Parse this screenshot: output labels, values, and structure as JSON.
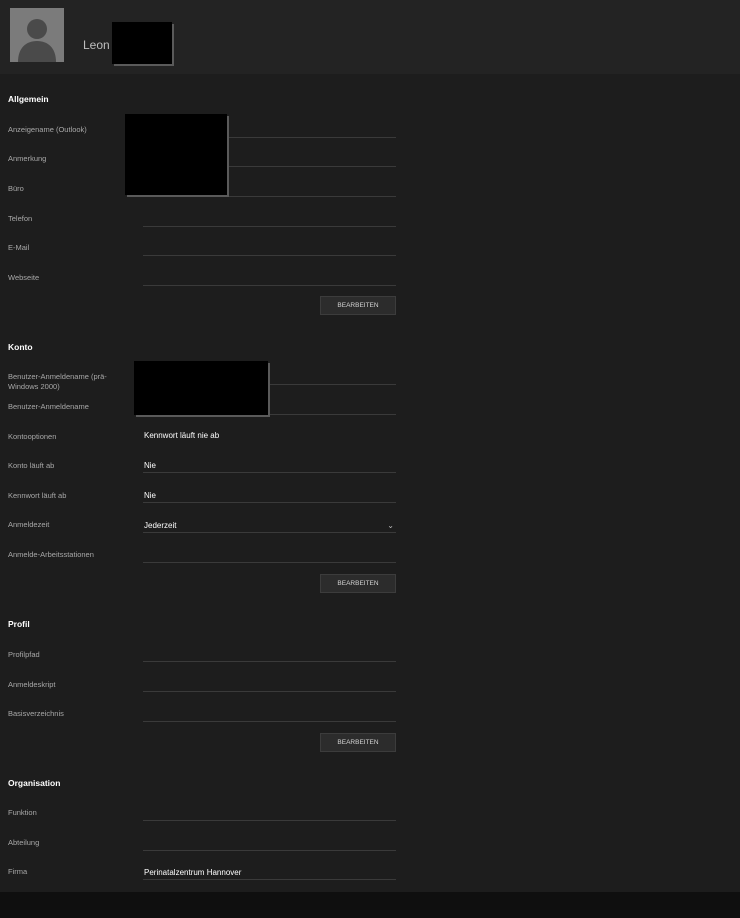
{
  "header": {
    "user_name": "Leon"
  },
  "sections": {
    "allgemein": {
      "title": "Allgemein",
      "fields": [
        {
          "label": "Anzeigename (Outlook)",
          "value": ""
        },
        {
          "label": "Anmerkung",
          "value": ""
        },
        {
          "label": "Büro",
          "value": ""
        },
        {
          "label": "Telefon",
          "value": ""
        },
        {
          "label": "E-Mail",
          "value": ""
        },
        {
          "label": "Webseite",
          "value": ""
        }
      ],
      "button": "BEARBEITEN"
    },
    "konto": {
      "title": "Konto",
      "fields": [
        {
          "label": "Benutzer-Anmeldename (prä-Windows 2000)",
          "value": ""
        },
        {
          "label": "Benutzer-Anmeldename",
          "value": ""
        },
        {
          "label": "Kontooptionen",
          "value": "Kennwort läuft nie ab"
        },
        {
          "label": "Konto läuft ab",
          "value": "Nie"
        },
        {
          "label": "Kennwort läuft ab",
          "value": "Nie"
        },
        {
          "label": "Anmeldezeit",
          "value": "Jederzeit"
        },
        {
          "label": "Anmelde-Arbeitsstationen",
          "value": ""
        }
      ],
      "button": "BEARBEITEN"
    },
    "profil": {
      "title": "Profil",
      "fields": [
        {
          "label": "Profilpfad",
          "value": ""
        },
        {
          "label": "Anmeldeskript",
          "value": ""
        },
        {
          "label": "Basisverzeichnis",
          "value": ""
        }
      ],
      "button": "BEARBEITEN"
    },
    "organisation": {
      "title": "Organisation",
      "fields": [
        {
          "label": "Funktion",
          "value": ""
        },
        {
          "label": "Abteilung",
          "value": ""
        },
        {
          "label": "Firma",
          "value": "Perinatalzentrum Hannover"
        }
      ]
    }
  },
  "icons": {
    "avatar": "user-silhouette-icon",
    "dropdown": "chevron-down-icon"
  },
  "colors": {
    "background": "#1b1b1b",
    "header": "#232323",
    "text": "#ffffff",
    "label": "#a8a8a8"
  }
}
